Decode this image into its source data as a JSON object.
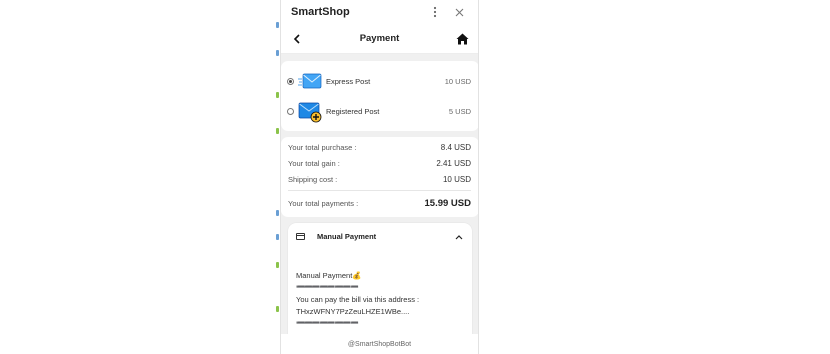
{
  "window": {
    "title": "SmartShop",
    "more_icon": "more-vertical-icon",
    "close_icon": "close-icon"
  },
  "nav": {
    "title": "Payment",
    "back_icon": "chevron-left-icon",
    "home_icon": "home-icon"
  },
  "shipping": {
    "options": [
      {
        "name": "Express Post",
        "price": "10 USD",
        "selected": true,
        "icon": "envelope-fast-icon"
      },
      {
        "name": "Registered Post",
        "price": "5 USD",
        "selected": false,
        "icon": "envelope-add-icon"
      }
    ]
  },
  "summary": {
    "purchase_label": "Your total purchase :",
    "purchase_value": "8.4 USD",
    "gain_label": "Your total gain :",
    "gain_value": "2.41 USD",
    "shipping_label": "Shipping cost :",
    "shipping_value": "10 USD",
    "total_label": "Your total payments :",
    "total_value": "15.99 USD"
  },
  "payment": {
    "method_title": "Manual Payment",
    "body_title": "Manual Payment💰",
    "dashes": "➖➖➖➖➖➖➖➖",
    "instruction": "You can pay the bill via this address :",
    "address": "THxzWFNY7PzZeuLHZE1WBe....",
    "dashes_bottom": "➖➖➖➖➖➖➖➖"
  },
  "footer": {
    "text": "@SmartShopBotBot"
  },
  "colors": {
    "app_bg": "#f0f0f0",
    "card_bg": "#ffffff",
    "envelope_blue": "#1e88e5",
    "badge_yellow": "#fbc02d"
  }
}
